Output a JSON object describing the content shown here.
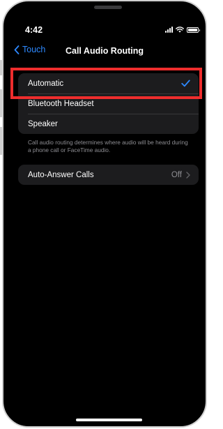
{
  "status_bar": {
    "time": "4:42"
  },
  "nav": {
    "back_label": "Touch",
    "title": "Call Audio Routing"
  },
  "audio_routing": {
    "options": [
      {
        "label": "Automatic",
        "selected": true
      },
      {
        "label": "Bluetooth Headset",
        "selected": false
      },
      {
        "label": "Speaker",
        "selected": false
      }
    ],
    "footnote": "Call audio routing determines where audio will be heard during a phone call or FaceTime audio."
  },
  "auto_answer": {
    "label": "Auto-Answer Calls",
    "value": "Off"
  },
  "colors": {
    "accent": "#2e89ff",
    "highlight_box": "#ee2d2d",
    "cell_background": "#1c1c1e",
    "screen_background": "#000000"
  },
  "icons": {
    "back": "chevron-left-icon",
    "selected": "checkmark-icon",
    "disclosure": "chevron-right-icon"
  }
}
